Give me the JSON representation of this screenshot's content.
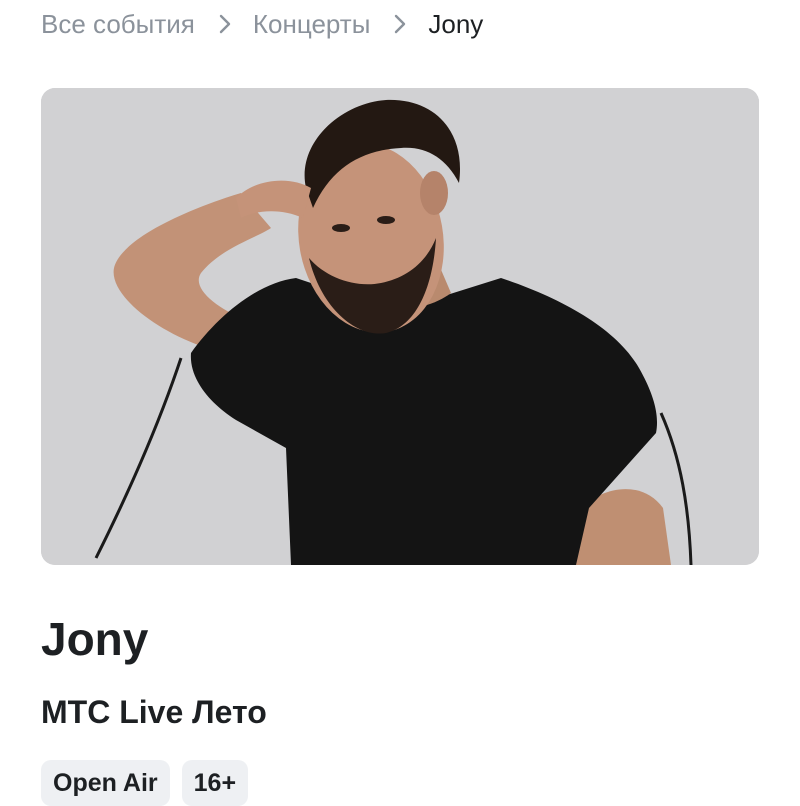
{
  "breadcrumb": {
    "items": [
      "Все события",
      "Концерты",
      "Jony"
    ]
  },
  "hero": {
    "background_color": "#d1d1d3",
    "subject": "person-photo"
  },
  "event": {
    "title": "Jony",
    "venue": "МТС Live Лето",
    "tags": [
      "Open Air",
      "16+"
    ]
  }
}
